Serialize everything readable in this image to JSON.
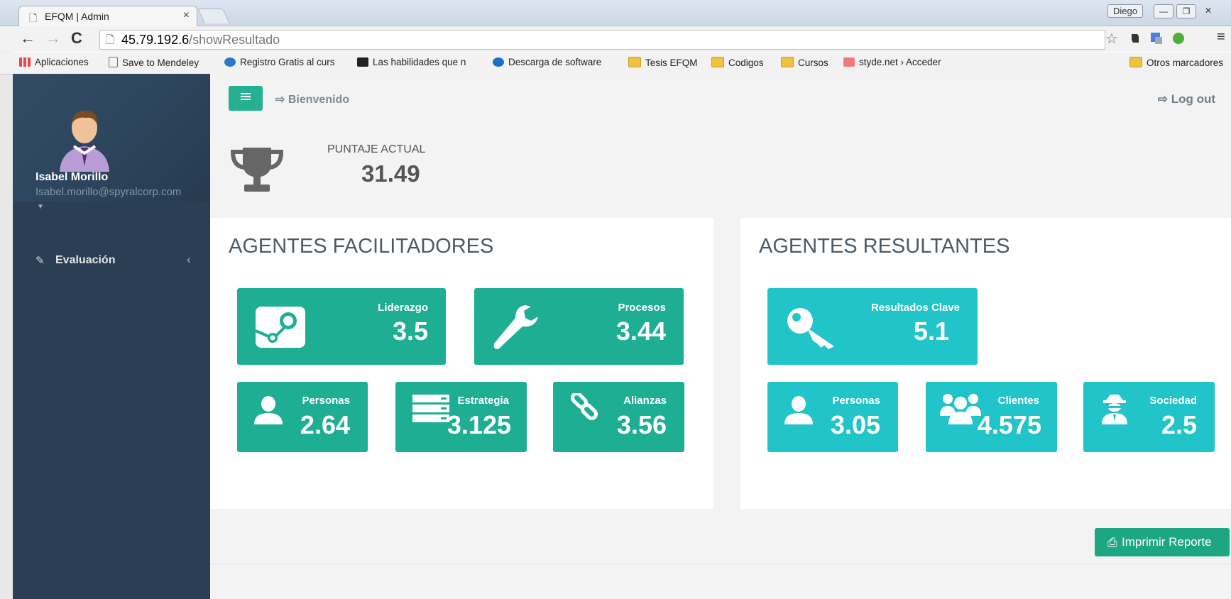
{
  "browser": {
    "tab_title": "EFQM | Admin",
    "tab_close": "×",
    "user_badge": "Diego",
    "url_host": "45.79.192.6",
    "url_path": "/showResultado",
    "bookmarks": [
      "Aplicaciones",
      "Save to Mendeley",
      "Registro Gratis al curs",
      "Las habilidades que n",
      "Descarga de software",
      "Tesis EFQM",
      "Codigos",
      "Cursos",
      "styde.net › Acceder"
    ],
    "other_bookmarks": "Otros marcadores"
  },
  "sidebar": {
    "user_name": "Isabel Morillo",
    "user_email": "Isabel.morillo@spyralcorp.com",
    "nav_item": "Evaluación",
    "nav_chevron": "‹"
  },
  "header": {
    "welcome": "Bienvenido",
    "logout": "Log out"
  },
  "score": {
    "label": "PUNTAJE ACTUAL",
    "value": "31.49"
  },
  "facilitadores": {
    "title": "AGENTES FACILITADORES",
    "tiles": [
      {
        "label": "Liderazgo",
        "value": "3.5",
        "icon": "steam-icon"
      },
      {
        "label": "Procesos",
        "value": "3.44",
        "icon": "wrench-icon"
      },
      {
        "label": "Personas",
        "value": "2.64",
        "icon": "user-icon"
      },
      {
        "label": "Estrategia",
        "value": "3.125",
        "icon": "server-icon"
      },
      {
        "label": "Alianzas",
        "value": "3.56",
        "icon": "link-icon"
      }
    ]
  },
  "resultantes": {
    "title": "AGENTES RESULTANTES",
    "tiles": [
      {
        "label": "Resultados Clave",
        "value": "5.1",
        "icon": "key-icon"
      },
      {
        "label": "Personas",
        "value": "3.05",
        "icon": "user-icon"
      },
      {
        "label": "Clientes",
        "value": "4.575",
        "icon": "users-icon"
      },
      {
        "label": "Sociedad",
        "value": "2.5",
        "icon": "user-secret-icon"
      }
    ]
  },
  "actions": {
    "print": "Imprimir Reporte"
  },
  "colors": {
    "sidebar": "#2a3f54",
    "green_tile": "#1eae93",
    "cyan_tile": "#21c4c9",
    "accent_button": "#1ca682"
  }
}
